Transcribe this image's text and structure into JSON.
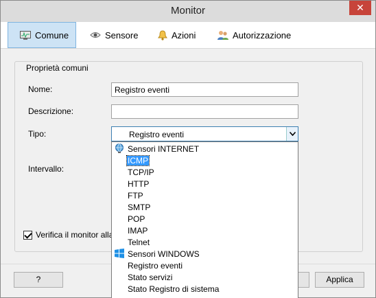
{
  "window": {
    "title": "Monitor",
    "close_label": "✕"
  },
  "tabs": [
    {
      "label": "Comune",
      "icon": "monitor-icon",
      "active": true
    },
    {
      "label": "Sensore",
      "icon": "eye-icon",
      "active": false
    },
    {
      "label": "Azioni",
      "icon": "bell-icon",
      "active": false
    },
    {
      "label": "Autorizzazione",
      "icon": "users-icon",
      "active": false
    }
  ],
  "group": {
    "legend": "Proprietà comuni"
  },
  "form": {
    "name_label": "Nome:",
    "name_value": "Registro eventi",
    "description_label": "Descrizione:",
    "description_value": "",
    "type_label": "Tipo:",
    "type_value": "Registro eventi",
    "interval_label": "Intervallo:",
    "verify_label": "Verifica il monitor alla cr"
  },
  "dropdown": {
    "items": [
      {
        "label": "Sensori INTERNET",
        "kind": "group",
        "icon": "globe-icon"
      },
      {
        "label": "ICMP",
        "kind": "item",
        "selected": true
      },
      {
        "label": "TCP/IP",
        "kind": "item"
      },
      {
        "label": "HTTP",
        "kind": "item"
      },
      {
        "label": "FTP",
        "kind": "item"
      },
      {
        "label": "SMTP",
        "kind": "item"
      },
      {
        "label": "POP",
        "kind": "item"
      },
      {
        "label": "IMAP",
        "kind": "item"
      },
      {
        "label": "Telnet",
        "kind": "item"
      },
      {
        "label": "Sensori WINDOWS",
        "kind": "group",
        "icon": "windows-icon"
      },
      {
        "label": "Registro eventi",
        "kind": "item"
      },
      {
        "label": "Stato servizi",
        "kind": "item"
      },
      {
        "label": "Stato Registro di sistema",
        "kind": "item"
      }
    ]
  },
  "footer": {
    "help_label": "?",
    "apply_label": "Applica"
  },
  "colors": {
    "accent": "#3399ff",
    "tab_active_bg": "#cde3f5",
    "close_bg": "#c7443a"
  }
}
